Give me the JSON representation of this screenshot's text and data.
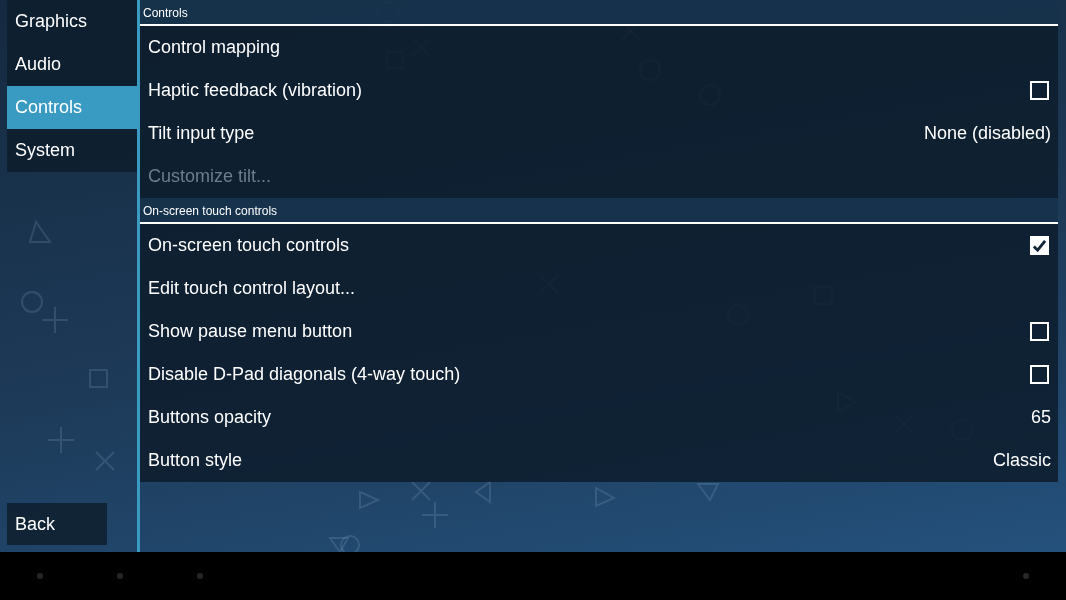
{
  "sidebar": {
    "items": [
      {
        "label": "Graphics",
        "selected": false
      },
      {
        "label": "Audio",
        "selected": false
      },
      {
        "label": "Controls",
        "selected": true
      },
      {
        "label": "System",
        "selected": false
      }
    ],
    "back_button": "Back"
  },
  "sections": [
    {
      "title": "Controls",
      "rows": [
        {
          "kind": "action",
          "label": "Control mapping",
          "disabled": false
        },
        {
          "kind": "checkbox",
          "label": "Haptic feedback (vibration)",
          "checked": false,
          "disabled": false
        },
        {
          "kind": "choice",
          "label": "Tilt input type",
          "value": "None (disabled)",
          "disabled": false
        },
        {
          "kind": "action",
          "label": "Customize tilt...",
          "disabled": true
        }
      ]
    },
    {
      "title": "On-screen touch controls",
      "rows": [
        {
          "kind": "checkbox",
          "label": "On-screen touch controls",
          "checked": true,
          "disabled": false
        },
        {
          "kind": "action",
          "label": "Edit touch control layout...",
          "disabled": false
        },
        {
          "kind": "checkbox",
          "label": "Show pause menu button",
          "checked": false,
          "disabled": false
        },
        {
          "kind": "checkbox",
          "label": "Disable D-Pad diagonals (4-way touch)",
          "checked": false,
          "disabled": false
        },
        {
          "kind": "choice",
          "label": "Buttons opacity",
          "value": "65",
          "disabled": false
        },
        {
          "kind": "choice",
          "label": "Button style",
          "value": "Classic",
          "disabled": false
        }
      ]
    }
  ]
}
